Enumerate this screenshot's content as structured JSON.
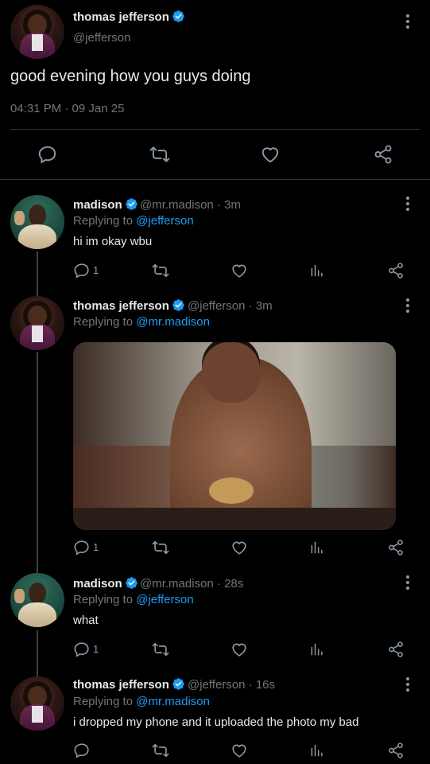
{
  "main_tweet": {
    "display_name": "thomas jefferson",
    "handle": "@jefferson",
    "text": "good evening how you guys doing",
    "timestamp": "04:31 PM · 09 Jan 25"
  },
  "replies": [
    {
      "display_name": "madison",
      "handle_time": "@mr.madison · 3m",
      "replying_prefix": "Replying to ",
      "replying_to": "@jefferson",
      "text": "hi im okay wbu",
      "reply_count": "1"
    },
    {
      "display_name": "thomas jefferson",
      "handle_time": "@jefferson · 3m",
      "replying_prefix": "Replying to ",
      "replying_to": "@mr.madison",
      "text": "",
      "reply_count": "1"
    },
    {
      "display_name": "madison",
      "handle_time": "@mr.madison · 28s",
      "replying_prefix": "Replying to ",
      "replying_to": "@jefferson",
      "text": "what",
      "reply_count": "1"
    },
    {
      "display_name": "thomas jefferson",
      "handle_time": "@jefferson · 16s",
      "replying_prefix": "Replying to ",
      "replying_to": "@mr.madison",
      "text": "i dropped my phone and it uploaded the photo my bad",
      "reply_count": ""
    }
  ],
  "icons": {
    "verified": "verified-badge-icon",
    "reply": "reply-icon",
    "retweet": "retweet-icon",
    "like": "heart-icon",
    "views": "analytics-icon",
    "share": "share-icon",
    "more": "more-vertical-icon"
  },
  "colors": {
    "background": "#000000",
    "accent": "#1d9bf0",
    "muted": "#71767b",
    "text": "#e7e9ea"
  }
}
